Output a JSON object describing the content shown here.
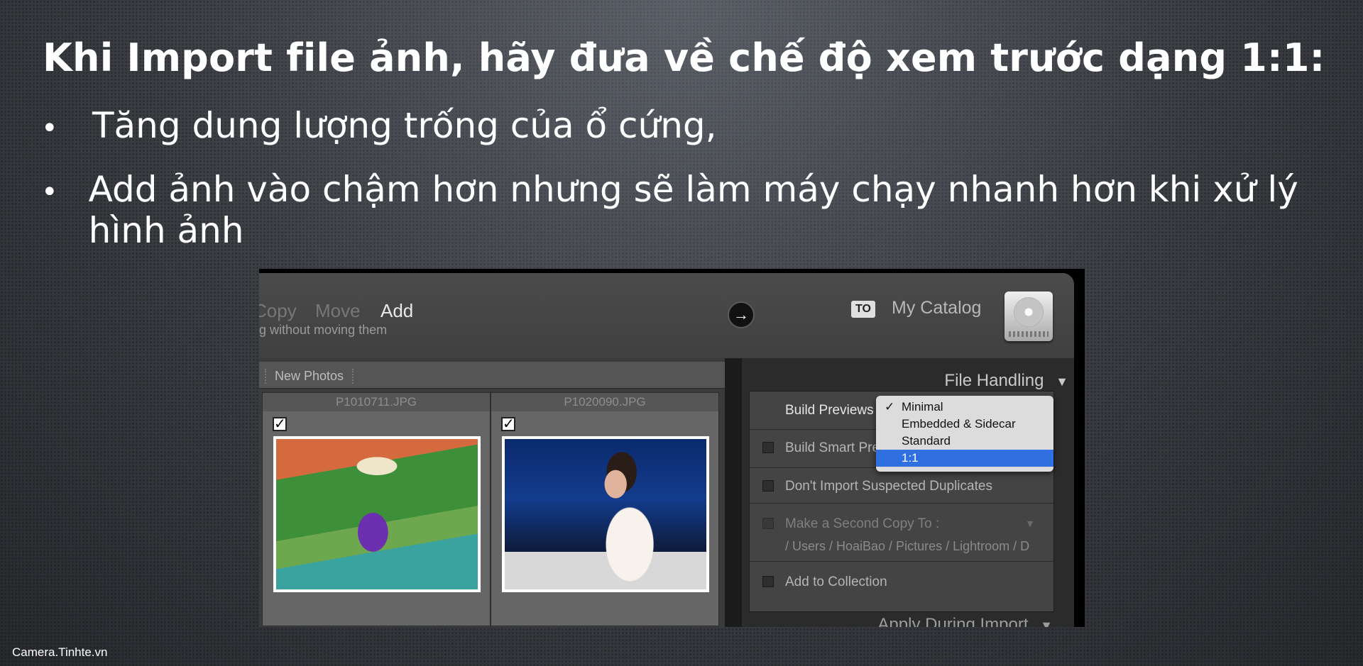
{
  "slide": {
    "title": "Khi Import file ảnh, hãy đưa về chế độ xem trước dạng 1:1:",
    "bullets": [
      "Tăng dung lượng trống của ổ cứng,",
      "Add ảnh vào chậm hơn nhưng sẽ làm máy chạy nhanh hơn khi xử lý hình ảnh"
    ],
    "bullet_glyph": "•",
    "watermark": "Camera.Tinhte.vn"
  },
  "lightroom": {
    "modes": [
      "Copy",
      "Move",
      "Add"
    ],
    "active_mode": "Add",
    "mode_description": "og without moving them",
    "arrow_icon": "→",
    "to_badge": "TO",
    "destination": "My Catalog",
    "grid": {
      "toolbar_label": "New Photos",
      "photos": [
        {
          "filename": "P1010711.JPG",
          "checked": true
        },
        {
          "filename": "P1020090.JPG",
          "checked": true
        }
      ],
      "check_glyph": "✓"
    },
    "file_handling": {
      "header": "File Handling",
      "collapse_glyph": "▼",
      "build_previews_label": "Build Previews",
      "dropdown_options": [
        "Minimal",
        "Embedded & Sidecar",
        "Standard",
        "1:1"
      ],
      "dropdown_checked": "Minimal",
      "dropdown_highlighted": "1:1",
      "build_smart_previews_label": "Build Smart Previews",
      "dont_import_duplicates_label": "Don't Import Suspected Duplicates",
      "second_copy_label": "Make a Second Copy To :",
      "second_copy_path": "/ Users / HoaiBao / Pictures / Lightroom / D",
      "add_to_collection_label": "Add to Collection"
    },
    "apply_during_import_header": "Apply During Import"
  }
}
